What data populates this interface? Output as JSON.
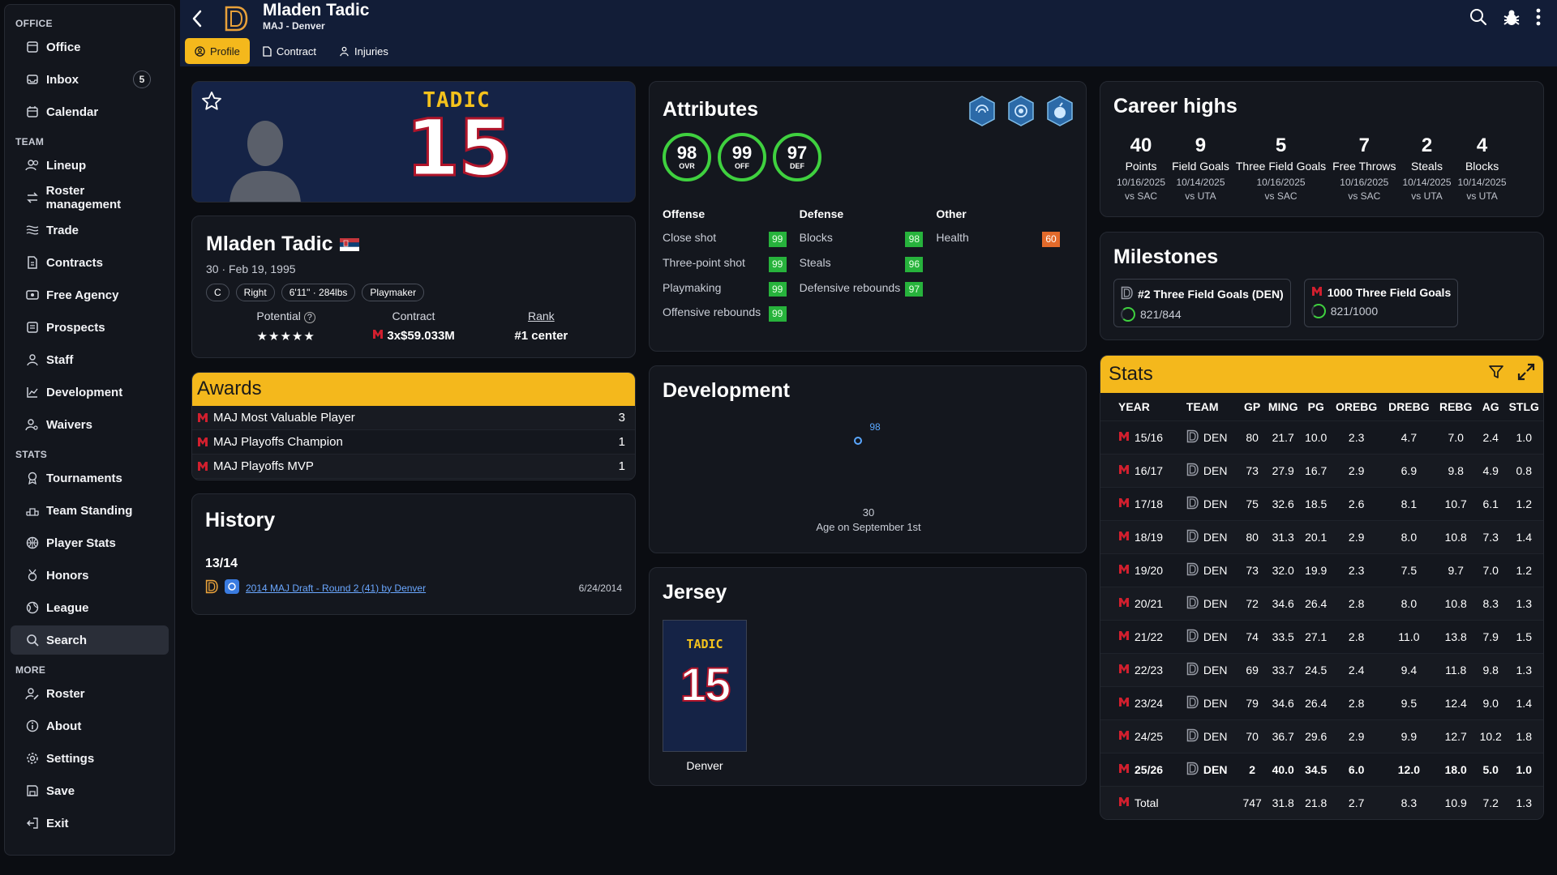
{
  "sidebar": {
    "sections": [
      {
        "title": "OFFICE",
        "items": [
          {
            "label": "Office",
            "icon": "briefcase-icon"
          },
          {
            "label": "Inbox",
            "icon": "inbox-icon",
            "badge": "5"
          },
          {
            "label": "Calendar",
            "icon": "calendar-icon"
          }
        ]
      },
      {
        "title": "TEAM",
        "items": [
          {
            "label": "Lineup",
            "icon": "people-icon"
          },
          {
            "label": "Roster management",
            "icon": "arrows-icon"
          },
          {
            "label": "Trade",
            "icon": "trade-icon"
          },
          {
            "label": "Contracts",
            "icon": "document-icon"
          },
          {
            "label": "Free Agency",
            "icon": "id-card-icon"
          },
          {
            "label": "Prospects",
            "icon": "folder-icon"
          },
          {
            "label": "Staff",
            "icon": "person-icon"
          },
          {
            "label": "Development",
            "icon": "chart-icon"
          },
          {
            "label": "Waivers",
            "icon": "user-search-icon"
          }
        ]
      },
      {
        "title": "STATS",
        "items": [
          {
            "label": "Tournaments",
            "icon": "trophy-icon"
          },
          {
            "label": "Team Standing",
            "icon": "podium-icon"
          },
          {
            "label": "Player Stats",
            "icon": "basketball-icon"
          },
          {
            "label": "Honors",
            "icon": "medal-icon"
          },
          {
            "label": "League",
            "icon": "globe-icon"
          },
          {
            "label": "Search",
            "icon": "search-icon",
            "active": true
          }
        ]
      },
      {
        "title": "MORE",
        "items": [
          {
            "label": "Roster",
            "icon": "user-edit-icon"
          },
          {
            "label": "About",
            "icon": "info-icon"
          },
          {
            "label": "Settings",
            "icon": "gear-icon"
          },
          {
            "label": "Save",
            "icon": "save-icon"
          },
          {
            "label": "Exit",
            "icon": "exit-icon"
          }
        ]
      }
    ]
  },
  "header": {
    "title": "Mladen Tadic",
    "subtitle": "MAJ - Denver",
    "tabs": [
      {
        "label": "Profile",
        "active": true
      },
      {
        "label": "Contract"
      },
      {
        "label": "Injuries"
      }
    ]
  },
  "hero": {
    "jersey_name": "TADIC",
    "jersey_number": "15"
  },
  "info": {
    "name": "Mladen Tadic",
    "dob": "30 · Feb 19, 1995",
    "chips": [
      "C",
      "Right",
      "6'11\" · 284lbs",
      "Playmaker"
    ],
    "potential_label": "Potential",
    "potential_stars": 5,
    "contract_label": "Contract",
    "contract_value": "3x$59.033M",
    "rank_label": "Rank",
    "rank_value": "#1 center"
  },
  "awards": {
    "title": "Awards",
    "items": [
      {
        "name": "MAJ Most Valuable Player",
        "count": "3"
      },
      {
        "name": "MAJ Playoffs Champion",
        "count": "1"
      },
      {
        "name": "MAJ Playoffs MVP",
        "count": "1"
      }
    ]
  },
  "history": {
    "title": "History",
    "season": "13/14",
    "event": "2014 MAJ Draft - Round 2 (41) by Denver",
    "date": "6/24/2014"
  },
  "attributes": {
    "title": "Attributes",
    "ovr": {
      "value": "98",
      "label": "OVR"
    },
    "off": {
      "value": "99",
      "label": "OFF"
    },
    "def": {
      "value": "97",
      "label": "DEF"
    },
    "offense": {
      "title": "Offense",
      "items": [
        {
          "label": "Close shot",
          "value": "99"
        },
        {
          "label": "Three-point shot",
          "value": "99"
        },
        {
          "label": "Playmaking",
          "value": "99"
        },
        {
          "label": "Offensive rebounds",
          "value": "99"
        }
      ]
    },
    "defense": {
      "title": "Defense",
      "items": [
        {
          "label": "Blocks",
          "value": "98"
        },
        {
          "label": "Steals",
          "value": "96"
        },
        {
          "label": "Defensive rebounds",
          "value": "97"
        }
      ]
    },
    "other": {
      "title": "Other",
      "items": [
        {
          "label": "Health",
          "value": "60"
        }
      ]
    }
  },
  "development": {
    "title": "Development",
    "point_value": "98",
    "age": "30",
    "age_label": "Age on September 1st"
  },
  "jersey": {
    "title": "Jersey",
    "name": "TADIC",
    "number": "15",
    "team": "Denver"
  },
  "career": {
    "title": "Career highs",
    "items": [
      {
        "value": "40",
        "label": "Points",
        "date": "10/16/2025",
        "opp": "vs SAC"
      },
      {
        "value": "9",
        "label": "Field Goals",
        "date": "10/14/2025",
        "opp": "vs UTA"
      },
      {
        "value": "5",
        "label": "Three Field Goals",
        "date": "10/16/2025",
        "opp": "vs SAC"
      },
      {
        "value": "7",
        "label": "Free Throws",
        "date": "10/16/2025",
        "opp": "vs SAC"
      },
      {
        "value": "2",
        "label": "Steals",
        "date": "10/14/2025",
        "opp": "vs UTA"
      },
      {
        "value": "4",
        "label": "Blocks",
        "date": "10/14/2025",
        "opp": "vs UTA"
      }
    ]
  },
  "milestones": {
    "title": "Milestones",
    "items": [
      {
        "label": "#2 Three Field Goals (DEN)",
        "progress": "821/844",
        "logo": "D"
      },
      {
        "label": "1000 Three Field Goals",
        "progress": "821/1000",
        "logo": "M"
      }
    ]
  },
  "stats": {
    "title": "Stats",
    "columns": [
      "YEAR",
      "TEAM",
      "GP",
      "MING",
      "PG",
      "OREBG",
      "DREBG",
      "REBG",
      "AG",
      "STLG"
    ],
    "rows": [
      {
        "year": "15/16",
        "team": "DEN",
        "v": [
          "80",
          "21.7",
          "10.0",
          "2.3",
          "4.7",
          "7.0",
          "2.4",
          "1.0"
        ]
      },
      {
        "year": "16/17",
        "team": "DEN",
        "v": [
          "73",
          "27.9",
          "16.7",
          "2.9",
          "6.9",
          "9.8",
          "4.9",
          "0.8"
        ]
      },
      {
        "year": "17/18",
        "team": "DEN",
        "v": [
          "75",
          "32.6",
          "18.5",
          "2.6",
          "8.1",
          "10.7",
          "6.1",
          "1.2"
        ]
      },
      {
        "year": "18/19",
        "team": "DEN",
        "v": [
          "80",
          "31.3",
          "20.1",
          "2.9",
          "8.0",
          "10.8",
          "7.3",
          "1.4"
        ]
      },
      {
        "year": "19/20",
        "team": "DEN",
        "v": [
          "73",
          "32.0",
          "19.9",
          "2.3",
          "7.5",
          "9.7",
          "7.0",
          "1.2"
        ]
      },
      {
        "year": "20/21",
        "team": "DEN",
        "v": [
          "72",
          "34.6",
          "26.4",
          "2.8",
          "8.0",
          "10.8",
          "8.3",
          "1.3"
        ]
      },
      {
        "year": "21/22",
        "team": "DEN",
        "v": [
          "74",
          "33.5",
          "27.1",
          "2.8",
          "11.0",
          "13.8",
          "7.9",
          "1.5"
        ]
      },
      {
        "year": "22/23",
        "team": "DEN",
        "v": [
          "69",
          "33.7",
          "24.5",
          "2.4",
          "9.4",
          "11.8",
          "9.8",
          "1.3"
        ]
      },
      {
        "year": "23/24",
        "team": "DEN",
        "v": [
          "79",
          "34.6",
          "26.4",
          "2.8",
          "9.5",
          "12.4",
          "9.0",
          "1.4"
        ]
      },
      {
        "year": "24/25",
        "team": "DEN",
        "v": [
          "70",
          "36.7",
          "29.6",
          "2.9",
          "9.9",
          "12.7",
          "10.2",
          "1.8"
        ]
      },
      {
        "year": "25/26",
        "team": "DEN",
        "v": [
          "2",
          "40.0",
          "34.5",
          "6.0",
          "12.0",
          "18.0",
          "5.0",
          "1.0"
        ],
        "bold": true
      }
    ],
    "total": {
      "label": "Total",
      "v": [
        "747",
        "31.8",
        "21.8",
        "2.7",
        "8.3",
        "10.9",
        "7.2",
        "1.3"
      ]
    }
  },
  "colors": {
    "accent": "#f4b81c",
    "header_bg": "#121d37",
    "rating_green": "#27b33c",
    "rating_orange": "#e26a2b",
    "link": "#6aa7ff"
  }
}
